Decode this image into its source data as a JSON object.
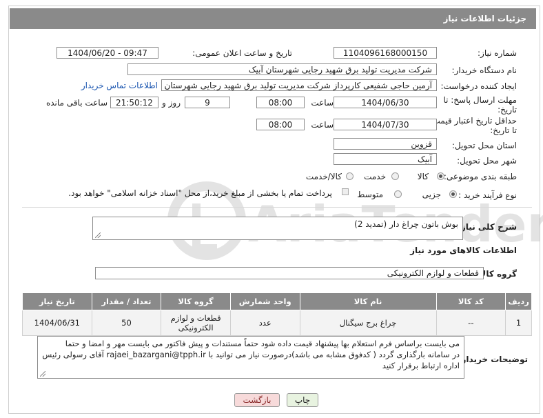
{
  "window": {
    "title": "جزئیات اطلاعات نیاز"
  },
  "fields": {
    "need_number": {
      "label": "شماره نیاز:",
      "value": "1104096168000150"
    },
    "announce": {
      "label": "تاریخ و ساعت اعلان عمومی:",
      "value": "1404/06/20 - 09:47"
    },
    "buyer_org": {
      "label": "نام دستگاه خریدار:",
      "value": "شرکت مدیریت تولید برق شهید رجایی شهرستان آبیک"
    },
    "requester": {
      "label": "ایجاد کننده درخواست:",
      "value": "آرمین حاجی شفیعی کارپرداز شرکت مدیریت تولید برق شهید رجایی شهرستان",
      "contact_link": "اطلاعات تماس خریدار"
    },
    "reply_deadline": {
      "label_line1": "مهلت ارسال پاسخ: تا",
      "label_line2": "تاریخ:",
      "date": "1404/06/30",
      "time_label": "ساعت",
      "time": "08:00",
      "days": "9",
      "days_label": "روز و",
      "remaining": "21:50:12",
      "remaining_label": "ساعت باقی مانده"
    },
    "price_validity": {
      "label_line1": "حداقل تاریخ اعتبار قیمت:",
      "label_line2": "تا تاریخ:",
      "date": "1404/07/30",
      "time_label": "ساعت",
      "time": "08:00"
    },
    "province": {
      "label": "استان محل تحویل:",
      "value": "قزوین"
    },
    "city": {
      "label": "شهر محل تحویل:",
      "value": "آبیک"
    },
    "category": {
      "label": "طبقه بندی موضوعی:",
      "options": [
        "کالا",
        "خدمت",
        "کالا/خدمت"
      ],
      "selected": "کالا"
    },
    "purchase_type": {
      "label": "نوع فرآیند خرید :",
      "options": [
        "جزیی",
        "متوسط"
      ],
      "selected": "جزیی",
      "payment_note": "پرداخت تمام یا بخشی از مبلغ خرید،از محل \"اسناد خزانه اسلامی\" خواهد بود."
    }
  },
  "description": {
    "label": "شرح کلی نیاز:",
    "value": "بوش باتون چراغ دار (تمدید 2)"
  },
  "goods_info": {
    "heading": "اطلاعات کالاهای مورد نیاز",
    "group_label": "گروه کالا:",
    "group_value": "قطعات و لوازم الکترونیکی"
  },
  "table": {
    "headers": [
      "ردیف",
      "کد کالا",
      "نام کالا",
      "واحد شمارش",
      "گروه کالا",
      "تعداد / مقدار",
      "تاریخ نیاز"
    ],
    "rows": [
      [
        "1",
        "--",
        "چراغ برج سیگنال",
        "عدد",
        "قطعات و لوازم الکترونیکی",
        "50",
        "1404/06/31"
      ]
    ]
  },
  "buyer_notes": {
    "label": "توضیحات خریدار:",
    "line1": "می بایست براساس فرم استعلام بها پیشنهاد قیمت داده شود حتماً مستندات و پیش فاکتور می بایست مهر و امضا و حتما",
    "line2": "در سامانه بارگذاری گردد ( کدفوق مشابه می باشد)درصورت نیاز می توانید با rajaei_bazargani@tpph.ir آقای رسولی  رئیس",
    "line3": "اداره ارتباط برقرار کنید"
  },
  "buttons": {
    "print": "چاپ",
    "back": "بازگشت"
  },
  "watermark": {
    "text": "AriaTender.neT"
  },
  "colors": {
    "titlebar": "#8a8a8a",
    "link": "#1a55b0",
    "back_button_bg": "#f7dada",
    "print_button_bg": "#e8f3e0"
  }
}
